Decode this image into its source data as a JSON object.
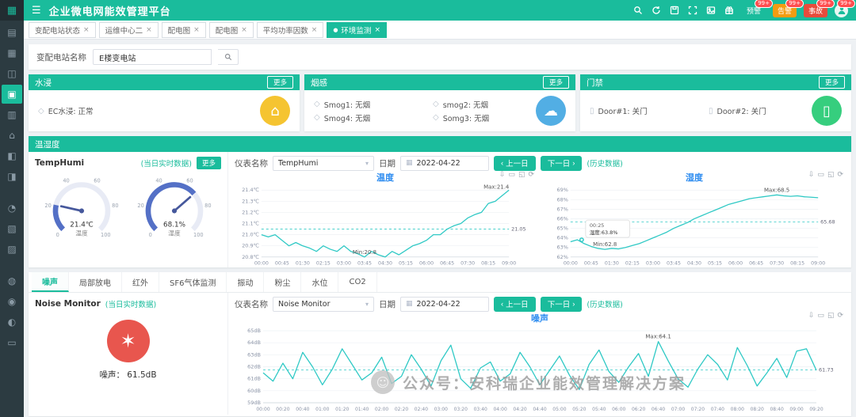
{
  "header": {
    "title": "企业微电网能效管理平台",
    "badges": [
      {
        "label": "预警",
        "count": "99+",
        "color": "#1abc9c"
      },
      {
        "label": "告警",
        "count": "99+",
        "color": "#f39c12"
      },
      {
        "label": "事故",
        "count": "99+",
        "color": "#e74c3c"
      }
    ],
    "avatar_count": "99+"
  },
  "sidebar": {
    "active": 3,
    "gaps": [
      8,
      11
    ],
    "icons": [
      {
        "glyph": "▤",
        "name": "sidebar-icon-overview"
      },
      {
        "glyph": "▦",
        "name": "sidebar-icon-monitor"
      },
      {
        "glyph": "◫",
        "name": "sidebar-icon-power"
      },
      {
        "glyph": "▣",
        "name": "sidebar-icon-environment"
      },
      {
        "glyph": "▥",
        "name": "sidebar-icon-energy"
      },
      {
        "glyph": "⌂",
        "name": "sidebar-icon-station"
      },
      {
        "glyph": "◧",
        "name": "sidebar-icon-report"
      },
      {
        "glyph": "◨",
        "name": "sidebar-icon-chart"
      },
      {
        "glyph": "◔",
        "name": "sidebar-icon-analysis"
      },
      {
        "glyph": "▧",
        "name": "sidebar-icon-alarm"
      },
      {
        "glyph": "▨",
        "name": "sidebar-icon-device"
      },
      {
        "glyph": "◍",
        "name": "sidebar-icon-settings"
      },
      {
        "glyph": "◉",
        "name": "sidebar-icon-user"
      },
      {
        "glyph": "◐",
        "name": "sidebar-icon-system"
      },
      {
        "glyph": "▭",
        "name": "sidebar-icon-log"
      }
    ]
  },
  "tabs": [
    {
      "label": "变配电站状态"
    },
    {
      "label": "运维中心二"
    },
    {
      "label": "配电图"
    },
    {
      "label": "配电图"
    },
    {
      "label": "平均功率因数"
    },
    {
      "label": "环境监测",
      "active": true
    }
  ],
  "search": {
    "label": "变配电站名称",
    "value": "E楼变电站"
  },
  "panels": {
    "water": {
      "title": "水浸",
      "more": "更多",
      "items": [
        {
          "text": "EC水浸: 正常"
        }
      ],
      "icon_color": "#f5c431"
    },
    "smoke": {
      "title": "烟感",
      "more": "更多",
      "items": [
        {
          "text": "Smog1: 无烟"
        },
        {
          "text": "smog2: 无烟"
        },
        {
          "text": "Smog4: 无烟"
        },
        {
          "text": "Somg3: 无烟"
        }
      ],
      "icon_color": "#52aee4"
    },
    "door": {
      "title": "门禁",
      "more": "更多",
      "items": [
        {
          "text": "Door#1: 关门"
        },
        {
          "text": "Door#2: 关门"
        }
      ],
      "icon_color": "#36ce7e"
    }
  },
  "temphumi": {
    "section_title": "温湿度",
    "device": "TempHumi",
    "realtime_link": "(当日实时数据)",
    "more": "更多",
    "meter_label": "仪表名称",
    "meter_value": "TempHumi",
    "date_label": "日期",
    "date_value": "2022-04-22",
    "prev": "上一日",
    "next": "下一日",
    "history_link": "(历史数据)",
    "gauge_ticks": [
      0,
      20,
      40,
      60,
      80,
      100
    ],
    "gauges": [
      {
        "value": 21.4,
        "display": "21.4℃",
        "label": "温度"
      },
      {
        "value": 68.1,
        "display": "68.1%",
        "label": "湿度"
      }
    ]
  },
  "bottom": {
    "tabs": [
      "噪声",
      "局部放电",
      "红外",
      "SF6气体监测",
      "振动",
      "粉尘",
      "水位",
      "CO2"
    ],
    "device": "Noise Monitor",
    "realtime_link": "(当日实时数据)",
    "noise_value": "噪声： 61.5dB",
    "meter_label": "仪表名称",
    "meter_value": "Noise Monitor",
    "date_label": "日期",
    "date_value": "2022-04-22",
    "prev": "上一日",
    "next": "下一日",
    "history_link": "(历史数据)"
  },
  "watermark": "公众号：安科瑞企业能效管理解决方案",
  "chart_data": [
    {
      "type": "line",
      "title": "温度",
      "color": "#2fc9c5",
      "ymin": 20.8,
      "ymax": 21.4,
      "yticks": [
        "21.4℃",
        "21.3℃",
        "21.2℃",
        "21.1℃",
        "21.0℃",
        "20.9℃",
        "20.8℃"
      ],
      "xticks": [
        "00:00",
        "00:45",
        "01:30",
        "02:15",
        "03:00",
        "03:45",
        "04:30",
        "05:15",
        "06:00",
        "06:45",
        "07:30",
        "08:15",
        "09:00"
      ],
      "values": [
        21.0,
        20.98,
        21.0,
        20.95,
        20.9,
        20.93,
        20.9,
        20.88,
        20.85,
        20.9,
        20.87,
        20.85,
        20.9,
        20.85,
        20.83,
        20.8,
        20.85,
        20.82,
        20.8,
        20.85,
        20.82,
        20.86,
        20.9,
        20.92,
        20.95,
        21.0,
        21.0,
        21.05,
        21.08,
        21.1,
        21.15,
        21.18,
        21.2,
        21.28,
        21.3,
        21.35,
        21.4
      ],
      "max_label": "Max:21.4",
      "min_label": "Min:20.8",
      "avg": 21.05,
      "avg_label": "21.05"
    },
    {
      "type": "line",
      "title": "湿度",
      "color": "#2fc9c5",
      "ymin": 62,
      "ymax": 69,
      "yticks": [
        "69%",
        "68%",
        "67%",
        "66%",
        "65%",
        "64%",
        "63%",
        "62%"
      ],
      "xticks": [
        "00:00",
        "00:45",
        "01:30",
        "02:15",
        "03:00",
        "03:45",
        "04:30",
        "05:15",
        "06:00",
        "06:45",
        "07:30",
        "08:15",
        "09:00"
      ],
      "values": [
        63.6,
        63.8,
        63.4,
        63.1,
        62.9,
        62.8,
        62.9,
        62.85,
        63.0,
        63.2,
        63.4,
        63.7,
        64.0,
        64.3,
        64.6,
        65.0,
        65.3,
        65.6,
        66.0,
        66.3,
        66.6,
        66.9,
        67.2,
        67.5,
        67.7,
        67.9,
        68.1,
        68.2,
        68.3,
        68.4,
        68.5,
        68.4,
        68.35,
        68.4,
        68.3,
        68.25,
        68.2
      ],
      "max_label": "Max:68.5",
      "min_label": "Min:62.8",
      "avg": 65.68,
      "avg_label": "65.68",
      "tooltip": {
        "time": "00:25",
        "text": "湿度:63.8%",
        "frac": 0.045,
        "value": 63.8
      }
    },
    {
      "type": "line",
      "title": "噪声",
      "color": "#2fc9c5",
      "ymin": 59,
      "ymax": 65,
      "yticks": [
        "65dB",
        "64dB",
        "63dB",
        "62dB",
        "61dB",
        "60dB",
        "59dB"
      ],
      "xticks": [
        "00:00",
        "00:20",
        "00:40",
        "01:00",
        "01:20",
        "01:40",
        "02:00",
        "02:20",
        "02:40",
        "03:00",
        "03:20",
        "03:40",
        "04:00",
        "04:20",
        "04:40",
        "05:00",
        "05:20",
        "05:40",
        "06:00",
        "06:20",
        "06:40",
        "07:00",
        "07:20",
        "07:40",
        "08:00",
        "08:20",
        "08:40",
        "09:00",
        "09:20"
      ],
      "values": [
        61.5,
        60.8,
        62.3,
        61.0,
        63.2,
        62.0,
        60.5,
        61.8,
        63.5,
        62.2,
        60.9,
        61.5,
        62.8,
        60.6,
        61.2,
        63.0,
        61.8,
        60.4,
        62.5,
        63.8,
        61.0,
        60.2,
        61.9,
        62.4,
        60.8,
        61.4,
        63.2,
        62.0,
        60.5,
        61.7,
        62.9,
        61.3,
        60.1,
        62.2,
        63.4,
        61.6,
        60.7,
        62.0,
        63.1,
        61.2,
        64.1,
        62.5,
        61.0,
        60.3,
        61.8,
        63.0,
        62.2,
        60.9,
        63.6,
        62.1,
        60.4,
        61.5,
        62.7,
        61.1,
        63.3,
        63.5,
        61.7
      ],
      "max_label": "Max:64.1",
      "avg": 61.73,
      "avg_label": "61.73"
    }
  ]
}
